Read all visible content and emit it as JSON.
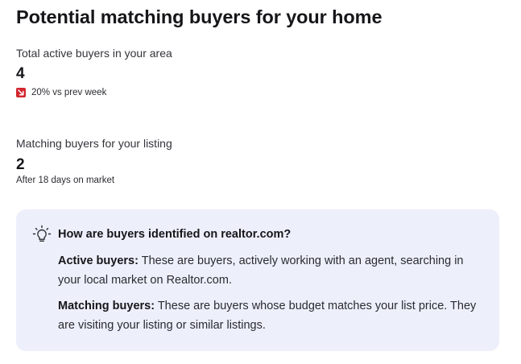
{
  "header": {
    "title": "Potential matching buyers for your home"
  },
  "total_active": {
    "label": "Total active buyers in your area",
    "value": "4",
    "trend_icon": "arrow-down-right-icon",
    "trend_color": "#d3262f",
    "trend_text": "20% vs prev week"
  },
  "matching": {
    "label": "Matching buyers for your listing",
    "value": "2",
    "note": "After 18 days on market"
  },
  "info": {
    "icon": "lightbulb-icon",
    "title": "How are buyers identified on realtor.com?",
    "active_term": "Active buyers:",
    "active_desc": "These are buyers, actively working with an agent, searching in your local market on Realtor.com.",
    "matching_term": "Matching buyers:",
    "matching_desc": "These are buyers whose budget matches your list price. They are visiting your listing or similar listings.",
    "background": "#edf0fb"
  }
}
